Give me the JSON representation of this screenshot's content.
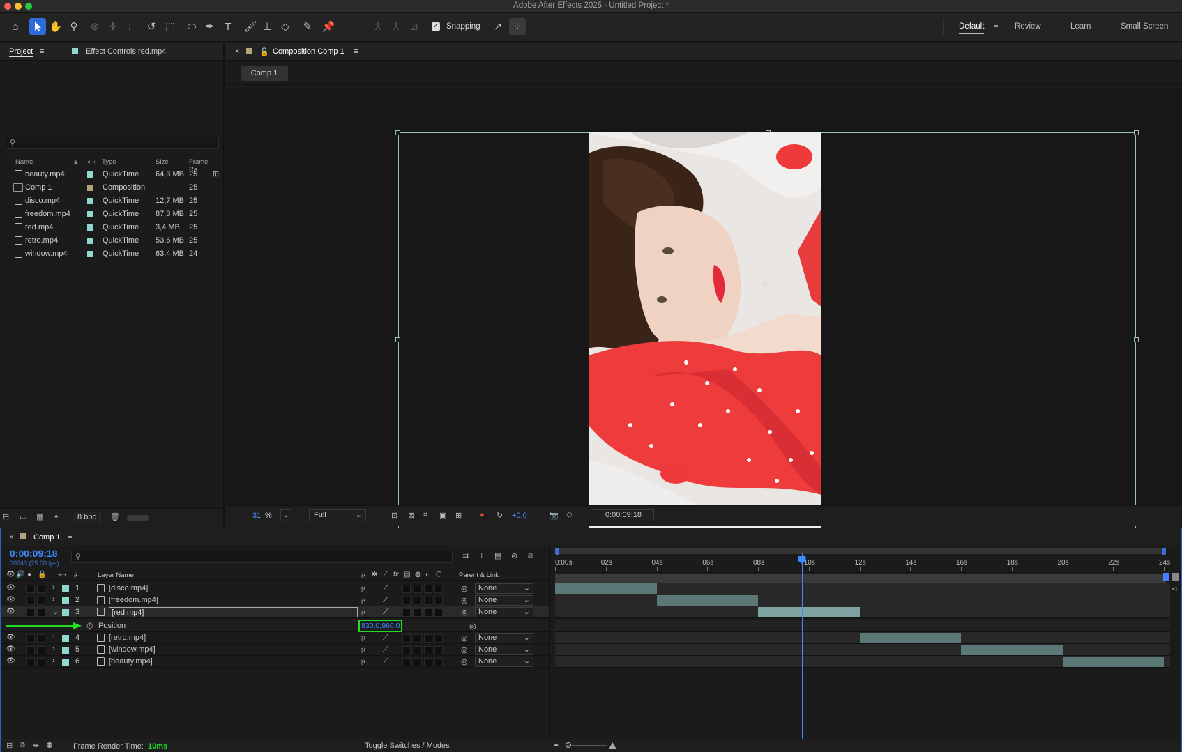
{
  "window": {
    "title": "Adobe After Effects 2025 - Untitled Project *"
  },
  "toolbar": {
    "snapping_label": "Snapping",
    "workspaces": [
      "Default",
      "Review",
      "Learn",
      "Small Screen"
    ]
  },
  "project_panel": {
    "tab_project": "Project",
    "tab_effect_controls": "Effect Controls red.mp4",
    "columns": {
      "name": "Name",
      "type": "Type",
      "size": "Size",
      "frame_rate": "Frame Ra..."
    },
    "items": [
      {
        "name": "beauty.mp4",
        "type": "QuickTime",
        "size": "64,3 MB",
        "fps": "25",
        "label_color": "#8fd6cf"
      },
      {
        "name": "Comp 1",
        "type": "Composition",
        "size": "",
        "fps": "25",
        "label_color": "#b4a47c"
      },
      {
        "name": "disco.mp4",
        "type": "QuickTime",
        "size": "12,7 MB",
        "fps": "25",
        "label_color": "#8fd6cf"
      },
      {
        "name": "freedom.mp4",
        "type": "QuickTime",
        "size": "87,3 MB",
        "fps": "25",
        "label_color": "#8fd6cf"
      },
      {
        "name": "red.mp4",
        "type": "QuickTime",
        "size": "3,4 MB",
        "fps": "25",
        "label_color": "#8fd6cf"
      },
      {
        "name": "retro.mp4",
        "type": "QuickTime",
        "size": "53,6 MB",
        "fps": "25",
        "label_color": "#8fd6cf"
      },
      {
        "name": "window.mp4",
        "type": "QuickTime",
        "size": "63,4 MB",
        "fps": "24",
        "label_color": "#8fd6cf"
      }
    ],
    "bpc": "8 bpc"
  },
  "comp_panel": {
    "tab_title": "Composition Comp 1",
    "comp_button": "Comp 1",
    "zoom": "31",
    "zoom_unit": "%",
    "resolution": "Full",
    "exposure": "+0,0",
    "timecode": "0:00:09:18"
  },
  "timeline": {
    "tab_title": "Comp 1",
    "timecode": "0:00:09:18",
    "frames": "00243 (25.00 fps)",
    "headers": {
      "num": "#",
      "layer_name": "Layer Name",
      "parent_link": "Parent & Link"
    },
    "layers": [
      {
        "num": "1",
        "name": "[disco.mp4]",
        "parent": "None",
        "bar_start": 0,
        "bar_end": 4
      },
      {
        "num": "2",
        "name": "[freedom.mp4]",
        "parent": "None",
        "bar_start": 4,
        "bar_end": 8
      },
      {
        "num": "3",
        "name": "[red.mp4]",
        "parent": "None",
        "bar_start": 8,
        "bar_end": 12
      },
      {
        "num": "4",
        "name": "[retro.mp4]",
        "parent": "None",
        "bar_start": 12,
        "bar_end": 16
      },
      {
        "num": "5",
        "name": "[window.mp4]",
        "parent": "None",
        "bar_start": 16,
        "bar_end": 20
      },
      {
        "num": "6",
        "name": "[beauty.mp4]",
        "parent": "None",
        "bar_start": 20,
        "bar_end": 24
      }
    ],
    "position_property": {
      "label": "Position",
      "value": "830,0,960,0"
    },
    "ruler": [
      "0:00s",
      "02s",
      "04s",
      "06s",
      "08s",
      "10s",
      "12s",
      "14s",
      "16s",
      "18s",
      "20s",
      "22s",
      "24s"
    ],
    "playhead_seconds": 9.72,
    "render_time_label": "Frame Render Time:",
    "render_time_value": "10ms",
    "toggle_label": "Toggle Switches / Modes"
  }
}
